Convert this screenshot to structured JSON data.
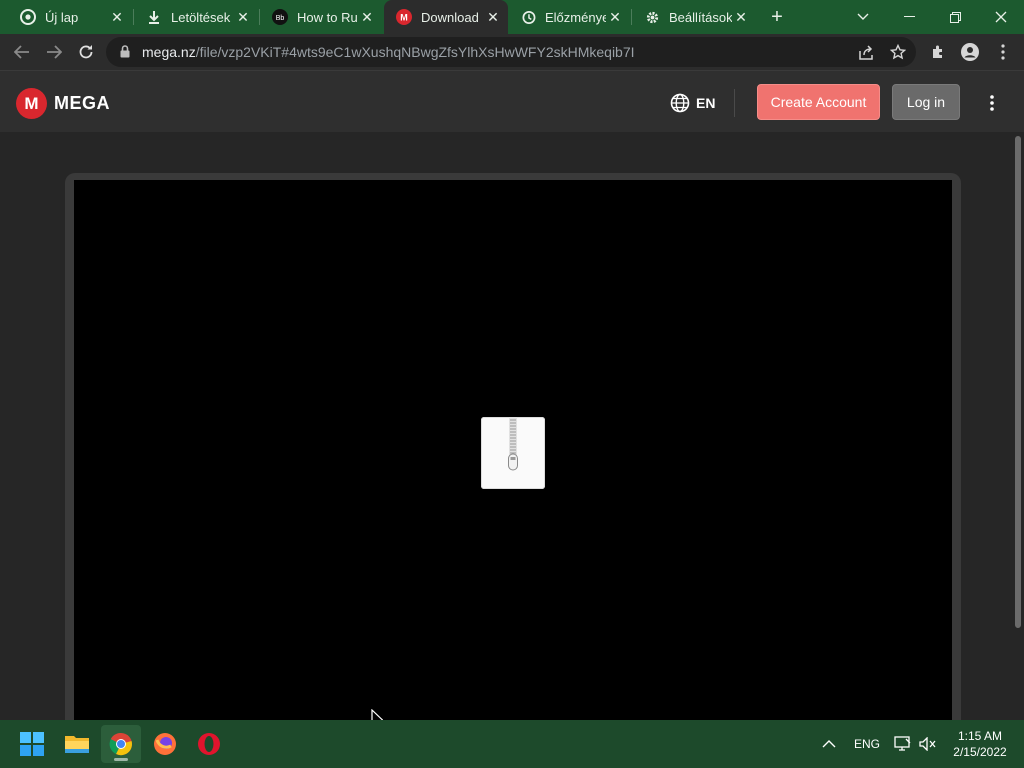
{
  "browser": {
    "tabs": [
      {
        "title": "Új lap",
        "icon": "chrome-icon"
      },
      {
        "title": "Letöltések",
        "icon": "download-icon"
      },
      {
        "title": "How to Ru",
        "icon": "bb-icon"
      },
      {
        "title": "Download",
        "icon": "mega-icon",
        "active": true
      },
      {
        "title": "Előzménye",
        "icon": "history-icon"
      },
      {
        "title": "Beállítások",
        "icon": "gear-icon"
      }
    ],
    "url_domain": "mega.nz",
    "url_path": "/file/vzp2VKiT#4wts9eC1wXushqNBwgZfsYlhXsHwWFY2skHMkeqib7I"
  },
  "mega": {
    "logo_letter": "M",
    "logo_text": "MEGA",
    "language": "EN",
    "create_account_label": "Create Account",
    "login_label": "Log in"
  },
  "taskbar": {
    "language": "ENG",
    "time": "1:15 AM",
    "date": "2/15/2022"
  },
  "colors": {
    "tabstrip": "#1c5a2f",
    "mega_red": "#d9272e",
    "create_button": "#f0736f",
    "taskbar": "#1d4a2b"
  }
}
